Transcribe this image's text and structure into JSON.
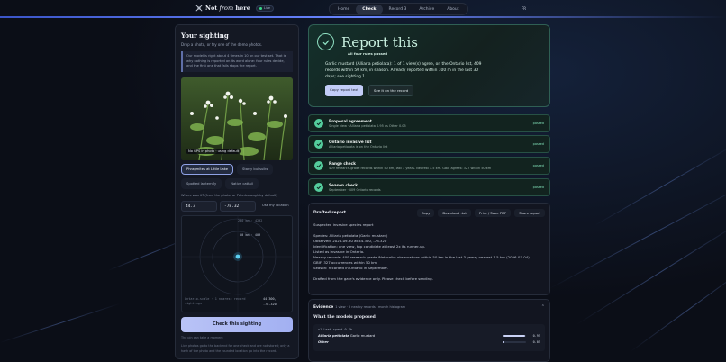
{
  "nav": {
    "brand_pre": "Not ",
    "brand_em": "from",
    "brand_post": " here",
    "live_label": "Live",
    "tabs": [
      {
        "label": "Home"
      },
      {
        "label": "Check"
      },
      {
        "label": "Record"
      },
      {
        "label": "Archive"
      },
      {
        "label": "About"
      }
    ],
    "record_badge": "3",
    "lang": "FR"
  },
  "sighting": {
    "title": "Your sighting",
    "subtitle": "Drop a photo, or try one of the demo photos.",
    "note": "Our model is right about 4 times in 10 on our test set. That is why nothing is reported on its word alone: four rules decide, and the first one that fails stops the report.",
    "gps_badge": "No GPS in photo · using default",
    "demo_chips": [
      {
        "label": "Phragmites at Little Lake",
        "selected": true
      },
      {
        "label": "Starry bullsuiks",
        "selected": false
      },
      {
        "label": "Spotted lanternfly",
        "selected": false
      },
      {
        "label": "Native cattail",
        "selected": false
      }
    ],
    "where_label": "Where was it? (from the photo, or Peterborough by default)",
    "lat": "44.3",
    "lon": "-78.32",
    "use_location": "Use my location",
    "map": {
      "top_label": "200 km · 4292",
      "ring_label": "50 km · 409",
      "footer_left": "Ontario-scale · 1 nearest record sightings",
      "footer_right_lat": "44.300,",
      "footer_right_lon": "-78.320"
    },
    "check_button": "Check this sighting",
    "tiny_1": "The pin can take a moment",
    "tiny_2": "Live photos go to the backend for one check and are not stored; only a hash of the photo and the rounded location go into the record."
  },
  "verdict": {
    "title": "Report this",
    "subtitle": "All four rules passed",
    "text": "Garlic mustard (Alliaria petiolata): 1 of 1 view(s) agree, on the Ontario list, 409 records within 50 km, in season. Already reported within 100 m in the last 30 days; see sighting 1.",
    "copy_button": "Copy report text",
    "see_button": "See it on the record"
  },
  "checks": [
    {
      "title": "Proposal agreement",
      "desc": "Single view · Alliaria petiolata 0.95 vs Other 0.05",
      "status": "passed"
    },
    {
      "title": "Ontario invasive list",
      "desc": "Alliaria petiolata is on the Ontario list",
      "status": "passed"
    },
    {
      "title": "Range check",
      "desc": "409 research-grade records within 50 km, last 3 years. Nearest 1.5 km. GBIF agrees: 327 within 50 km",
      "status": "passed"
    },
    {
      "title": "Season check",
      "desc": "September · 409 Ontario records",
      "status": "passed"
    }
  ],
  "draft": {
    "label": "Drafted report",
    "buttons": [
      "Copy",
      "Download .txt",
      "Print / Save PDF",
      "Share report"
    ],
    "text": "Suspected invasive species report\n\nSpecies: Alliaria petiolata (Garlic mustard)\nObserved: 2026-09-30 at 44.300, -78.320\nIdentification: one view, top candidate at least 2x its runner-up.\nListed as invasive in Ontario.\nNearby records: 409 research-grade iNaturalist observations within 50 km in the last 3 years; nearest 1.5 km (2026-07-04).\nGBIF: 327 occurrences within 50 km.\nSeason: recorded in Ontario in September.\n\nDrafted from the gate's evidence only. Please check before sending."
  },
  "evidence": {
    "title": "Evidence",
    "meta": "1 view · 5 nearby records · month histogram",
    "subtitle": "What the models proposed",
    "model_line": "v1 Leaf speed 0.7b",
    "rows": [
      {
        "name": "Alliaria petiolata",
        "common": "Garlic mustard",
        "value": 0.95,
        "value_text": "0.95"
      },
      {
        "name": "Other",
        "common": "",
        "value": 0.05,
        "value_text": "0.05"
      }
    ]
  },
  "colors": {
    "accent": "#a2b0f2",
    "pass": "#54cc9c",
    "live": "#39d98a"
  }
}
